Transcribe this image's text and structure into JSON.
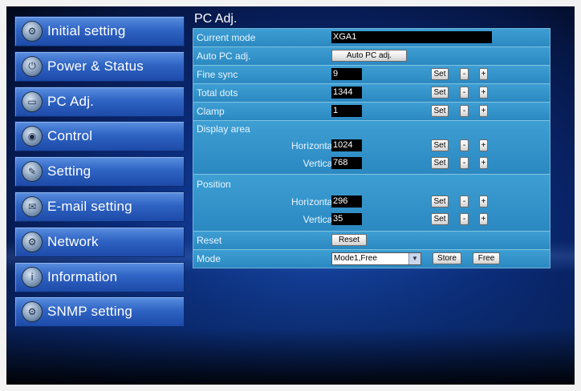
{
  "sidebar": {
    "items": [
      {
        "label": "Initial setting",
        "icon": "gear-icon",
        "glyph": "⚙"
      },
      {
        "label": "Power & Status",
        "icon": "power-icon",
        "glyph": "⏻"
      },
      {
        "label": "PC Adj.",
        "icon": "monitor-icon",
        "glyph": "▭"
      },
      {
        "label": "Control",
        "icon": "controller-icon",
        "glyph": "◉"
      },
      {
        "label": "Setting",
        "icon": "wrench-icon",
        "glyph": "✎"
      },
      {
        "label": "E-mail setting",
        "icon": "envelope-icon",
        "glyph": "✉"
      },
      {
        "label": "Network",
        "icon": "network-icon",
        "glyph": "⚙"
      },
      {
        "label": "Information",
        "icon": "info-icon",
        "glyph": "i"
      },
      {
        "label": "SNMP setting",
        "icon": "snmp-icon",
        "glyph": "⚙"
      }
    ]
  },
  "main": {
    "title": "PC Adj.",
    "current_mode": {
      "label": "Current mode",
      "value": "XGA1"
    },
    "auto_pc": {
      "label": "Auto PC adj.",
      "button": "Auto PC adj."
    },
    "fine_sync": {
      "label": "Fine sync",
      "value": "9"
    },
    "total_dots": {
      "label": "Total dots",
      "value": "1344"
    },
    "clamp": {
      "label": "Clamp",
      "value": "1"
    },
    "display_area": {
      "label": "Display area",
      "horizontal_label": "Horizontal",
      "horizontal_value": "1024",
      "vertical_label": "Vertical",
      "vertical_value": "768"
    },
    "position": {
      "label": "Position",
      "horizontal_label": "Horizontal",
      "horizontal_value": "296",
      "vertical_label": "Vertical",
      "vertical_value": "35"
    },
    "reset": {
      "label": "Reset",
      "button": "Reset"
    },
    "mode": {
      "label": "Mode",
      "selected": "Mode1,Free",
      "store": "Store",
      "free": "Free"
    },
    "set_label": "Set",
    "minus_label": "-",
    "plus_label": "+"
  }
}
